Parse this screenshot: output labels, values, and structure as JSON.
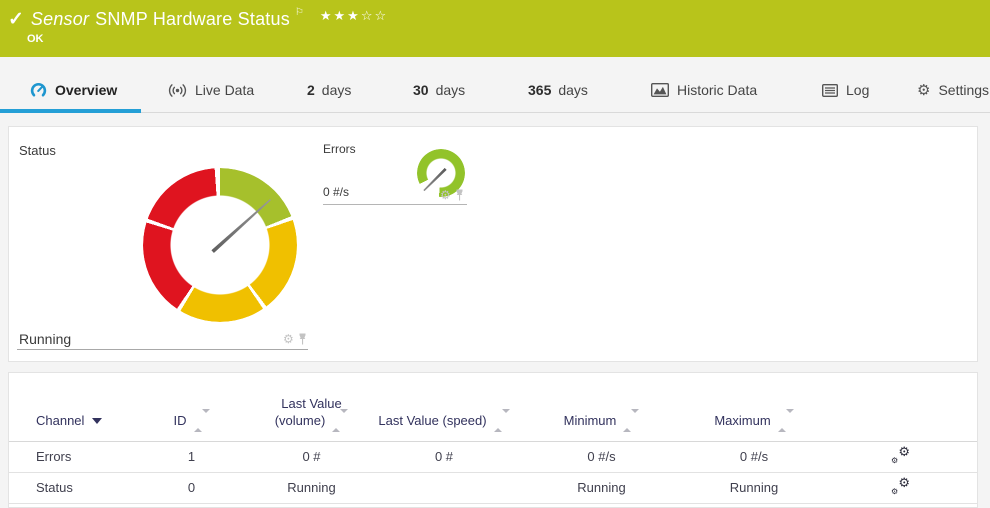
{
  "header": {
    "check_icon": "✓",
    "title_prefix": "Sensor",
    "title": "SNMP Hardware Status",
    "flag_icon": "⚐",
    "stars": "★★★☆☆",
    "rating": {
      "filled": 3,
      "total": 5
    },
    "status_text": "OK",
    "bg_color": "#b8c41b"
  },
  "tabs": {
    "overview": "Overview",
    "live_data": "Live Data",
    "d2_num": "2",
    "d2_label": "days",
    "d30_num": "30",
    "d30_label": "days",
    "d365_num": "365",
    "d365_label": "days",
    "historic": "Historic Data",
    "log": "Log",
    "settings": "Settings",
    "settings_gear": "⚙",
    "active_tab": "Overview",
    "accent_color": "#249fd6"
  },
  "gauges": {
    "status": {
      "title": "Status",
      "value": "Running",
      "type": "donut-gauge",
      "needle_deg": 48,
      "segments": [
        {
          "color": "#a6c02c",
          "from_deg": 0,
          "to_deg": 68
        },
        {
          "color": "#f0c000",
          "from_deg": 71,
          "to_deg": 143
        },
        {
          "color": "#f0c000",
          "from_deg": 146,
          "to_deg": 211
        },
        {
          "color": "#df141f",
          "from_deg": 214,
          "to_deg": 287
        },
        {
          "color": "#df141f",
          "from_deg": 290,
          "to_deg": 356
        }
      ],
      "gear_icon": "⚙"
    },
    "errors": {
      "title": "Errors",
      "value": "0 #/s",
      "type": "ring-gauge",
      "color": "#92c32a",
      "needle_deg": 225,
      "gear_icon": "⚙"
    }
  },
  "table": {
    "columns": {
      "channel": "Channel",
      "id": "ID",
      "last_volume": "Last Value (volume)",
      "last_speed": "Last Value (speed)",
      "minimum": "Minimum",
      "maximum": "Maximum"
    },
    "gear_icon": "⚙",
    "rows": [
      {
        "channel": "Errors",
        "id": "1",
        "last_volume": "0 #",
        "last_speed": "0 #",
        "minimum": "0 #/s",
        "maximum": "0 #/s"
      },
      {
        "channel": "Status",
        "id": "0",
        "last_volume": "Running",
        "last_speed": "",
        "minimum": "Running",
        "maximum": "Running"
      }
    ]
  }
}
